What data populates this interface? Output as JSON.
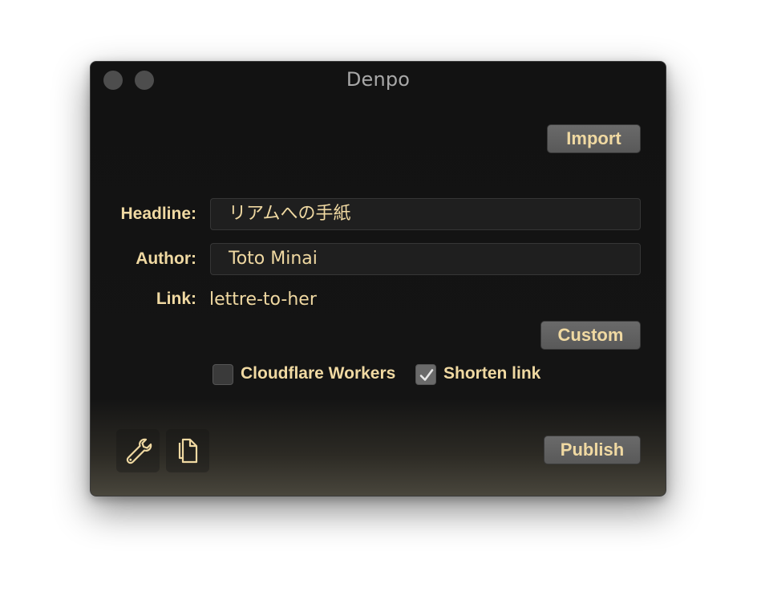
{
  "window": {
    "title": "Denpo"
  },
  "toolbar": {
    "import_label": "Import",
    "custom_label": "Custom",
    "publish_label": "Publish"
  },
  "form": {
    "headline_label": "Headline:",
    "headline_value": "リアムへの手紙",
    "author_label": "Author:",
    "author_value": "Toto Minai",
    "link_label": "Link:",
    "link_value": "lettre-to-her"
  },
  "options": {
    "cloudflare_label": "Cloudflare Workers",
    "cloudflare_checked": false,
    "shorten_label": "Shorten link",
    "shorten_checked": true
  },
  "footer": {
    "icons": [
      "wrench-icon",
      "copy-icon"
    ]
  },
  "colors": {
    "accent_text": "#f0d9a2",
    "button_bg": "#626262",
    "window_bg": "#121212"
  }
}
